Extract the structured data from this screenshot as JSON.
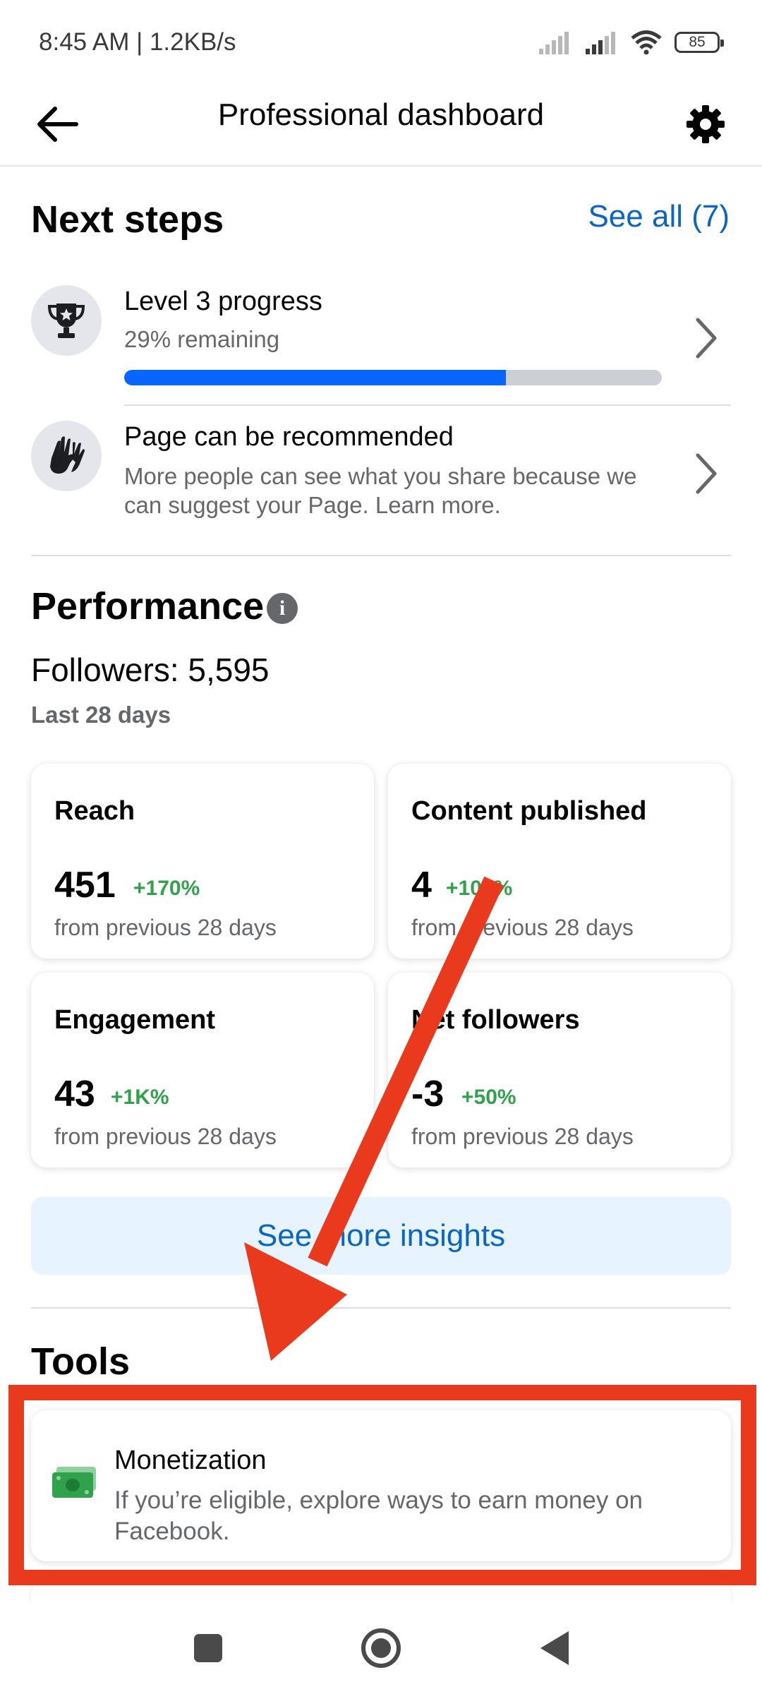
{
  "status_bar": {
    "time": "8:45 AM | 1.2KB/s",
    "battery": "85",
    "icons": [
      "signal-icon",
      "signal-icon",
      "wifi-icon",
      "battery-icon"
    ]
  },
  "header": {
    "title": "Professional dashboard",
    "back_icon": "arrow-left-icon",
    "settings_icon": "gear-icon"
  },
  "next_steps": {
    "title": "Next steps",
    "see_all": "See all (7)",
    "items": [
      {
        "icon": "trophy-icon",
        "title": "Level 3 progress",
        "subtitle": "29% remaining",
        "progress": 0.71
      },
      {
        "icon": "hands-icon",
        "title": "Page can be recommended",
        "subtitle": "More people can see what you share because we can suggest your Page. Learn more."
      }
    ]
  },
  "performance": {
    "title": "Performance",
    "followers": "Followers: 5,595",
    "period": "Last 28 days",
    "metrics": [
      {
        "label": "Reach",
        "value": "451",
        "change": "+170%",
        "footnote": "from previous 28 days"
      },
      {
        "label": "Content published",
        "value": "4",
        "change": "+100%",
        "footnote": "from previous 28 days"
      },
      {
        "label": "Engagement",
        "value": "43",
        "change": "+1K%",
        "footnote": "from previous 28 days"
      },
      {
        "label": "Net followers",
        "value": "-3",
        "change": "+50%",
        "footnote": "from previous 28 days"
      }
    ],
    "insights_button": "See more insights"
  },
  "tools": {
    "title": "Tools",
    "items": [
      {
        "icon": "money-icon",
        "title": "Monetization",
        "description": "If you’re eligible, explore ways to earn money on Facebook."
      }
    ]
  },
  "colors": {
    "accent": "#0a66c2",
    "progress": "#0866ff",
    "positive": "#31a24c",
    "annotation": "#ea3a1e"
  },
  "nav_bar": {
    "buttons": [
      "recents-square-icon",
      "home-circle-icon",
      "back-triangle-icon"
    ]
  }
}
